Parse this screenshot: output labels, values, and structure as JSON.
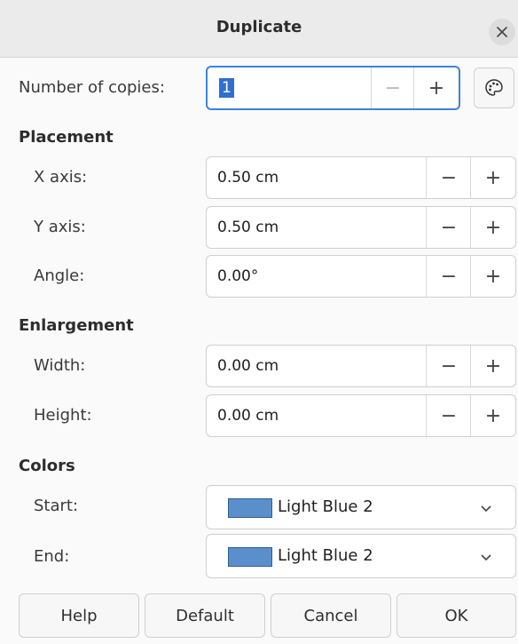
{
  "window": {
    "title": "Duplicate",
    "close_icon": "close-icon"
  },
  "copies": {
    "label": "Number of copies:",
    "value": "1",
    "minus": "−",
    "plus": "+",
    "values_button_icon": "color-palette-icon"
  },
  "placement": {
    "heading": "Placement",
    "x_axis": {
      "label": "X axis:",
      "value": "0.50 cm"
    },
    "y_axis": {
      "label": "Y axis:",
      "value": "0.50 cm"
    },
    "angle": {
      "label": "Angle:",
      "value": "0.00°"
    }
  },
  "enlargement": {
    "heading": "Enlargement",
    "width": {
      "label": "Width:",
      "value": "0.00 cm"
    },
    "height": {
      "label": "Height:",
      "value": "0.00 cm"
    }
  },
  "colors": {
    "heading": "Colors",
    "start": {
      "label": "Start:",
      "value": "Light Blue 2",
      "swatch": "#5b8fcc"
    },
    "end": {
      "label": "End:",
      "value": "Light Blue 2",
      "swatch": "#5b8fcc"
    }
  },
  "spin_buttons": {
    "minus": "−",
    "plus": "+"
  },
  "buttons": {
    "help": "Help",
    "default": "Default",
    "cancel": "Cancel",
    "ok": "OK"
  },
  "theme": {
    "focus": "#3c84d8",
    "selection": "#2f6fcf"
  }
}
